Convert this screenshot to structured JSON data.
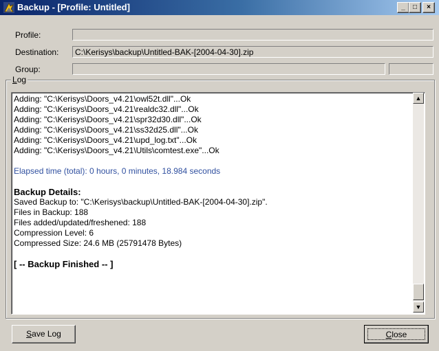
{
  "window": {
    "title": "Backup - [Profile: Untitled]",
    "controls": {
      "minimize": "_",
      "maximize": "□",
      "close": "×"
    }
  },
  "form": {
    "profile_label": "Profile:",
    "profile_value": "",
    "destination_label": "Destination:",
    "destination_value": "C:\\Kerisys\\backup\\Untitled-BAK-[2004-04-30].zip",
    "group_label": "Group:",
    "group_value": ""
  },
  "log": {
    "group_label_accel": "L",
    "group_label_rest": "og",
    "lines": [
      "Adding: \"C:\\Kerisys\\Doors_v4.21\\owl52t.dll\"...Ok",
      "Adding: \"C:\\Kerisys\\Doors_v4.21\\realdc32.dll\"...Ok",
      "Adding: \"C:\\Kerisys\\Doors_v4.21\\spr32d30.dll\"...Ok",
      "Adding: \"C:\\Kerisys\\Doors_v4.21\\ss32d25.dll\"...Ok",
      "Adding: \"C:\\Kerisys\\Doors_v4.21\\upd_log.txt\"...Ok",
      "Adding: \"C:\\Kerisys\\Doors_v4.21\\Utils\\comtest.exe\"...Ok"
    ],
    "elapsed": "Elapsed time (total): 0 hours, 0 minutes, 18.984 seconds",
    "details_heading": "Backup Details:",
    "details": [
      "Saved Backup to: \"C:\\Kerisys\\backup\\Untitled-BAK-[2004-04-30].zip\".",
      "Files in Backup: 188",
      "Files added/updated/freshened: 188",
      "Compression Level: 6",
      "Compressed Size: 24.6 MB (25791478 Bytes)"
    ],
    "finished": "[ -- Backup Finished -- ]"
  },
  "buttons": {
    "save_log_accel": "S",
    "save_log_rest": "ave Log",
    "close_accel": "C",
    "close_rest": "lose"
  },
  "scrollbar": {
    "up_icon": "▲",
    "down_icon": "▼"
  },
  "icons": {
    "app": "backup-app-icon"
  },
  "colors": {
    "title_start": "#0a246a",
    "title_end": "#a6caf0",
    "elapsed_text": "#2f4f9f"
  }
}
